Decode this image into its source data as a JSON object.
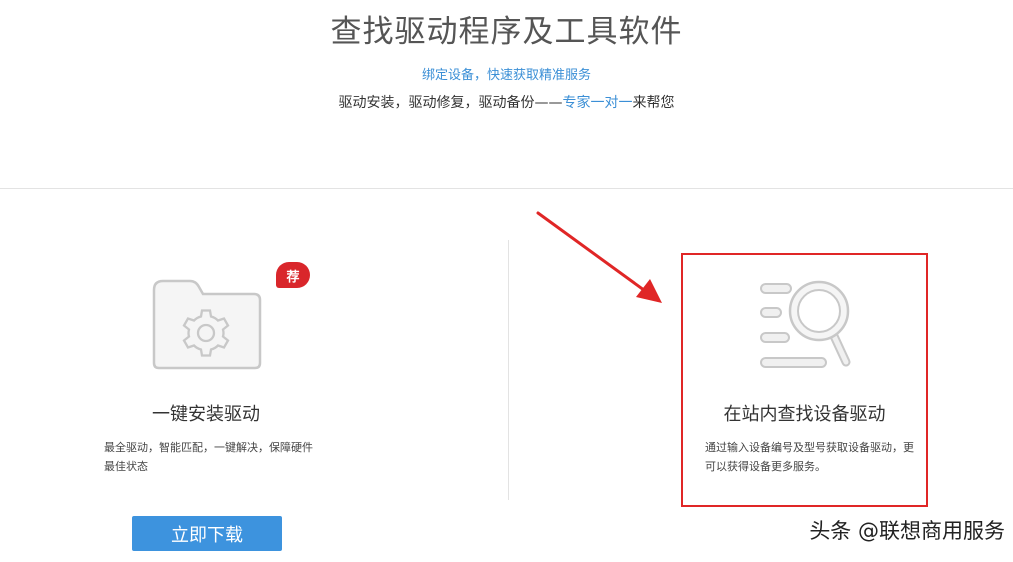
{
  "header": {
    "title": "查找驱动程序及工具软件",
    "bind_link": "绑定设备，快速获取精准服务",
    "subtitle_prefix": "驱动安装，驱动修复，驱动备份——",
    "subtitle_highlight": "专家一对一",
    "subtitle_suffix": "来帮您"
  },
  "left_card": {
    "badge": "荐",
    "title": "一键安装驱动",
    "description": "最全驱动，智能匹配，一键解决，保障硬件最佳状态",
    "button_label": "立即下载",
    "icon": "folder-gear-icon"
  },
  "right_card": {
    "title": "在站内查找设备驱动",
    "description": "通过输入设备编号及型号获取设备驱动，更可以获得设备更多服务。",
    "icon": "search-list-icon"
  },
  "watermark": "头条 @联想商用服务",
  "colors": {
    "accent_blue": "#3b8fd6",
    "button_blue": "#3d93de",
    "highlight_red": "#e02626",
    "badge_red": "#d9262b"
  }
}
